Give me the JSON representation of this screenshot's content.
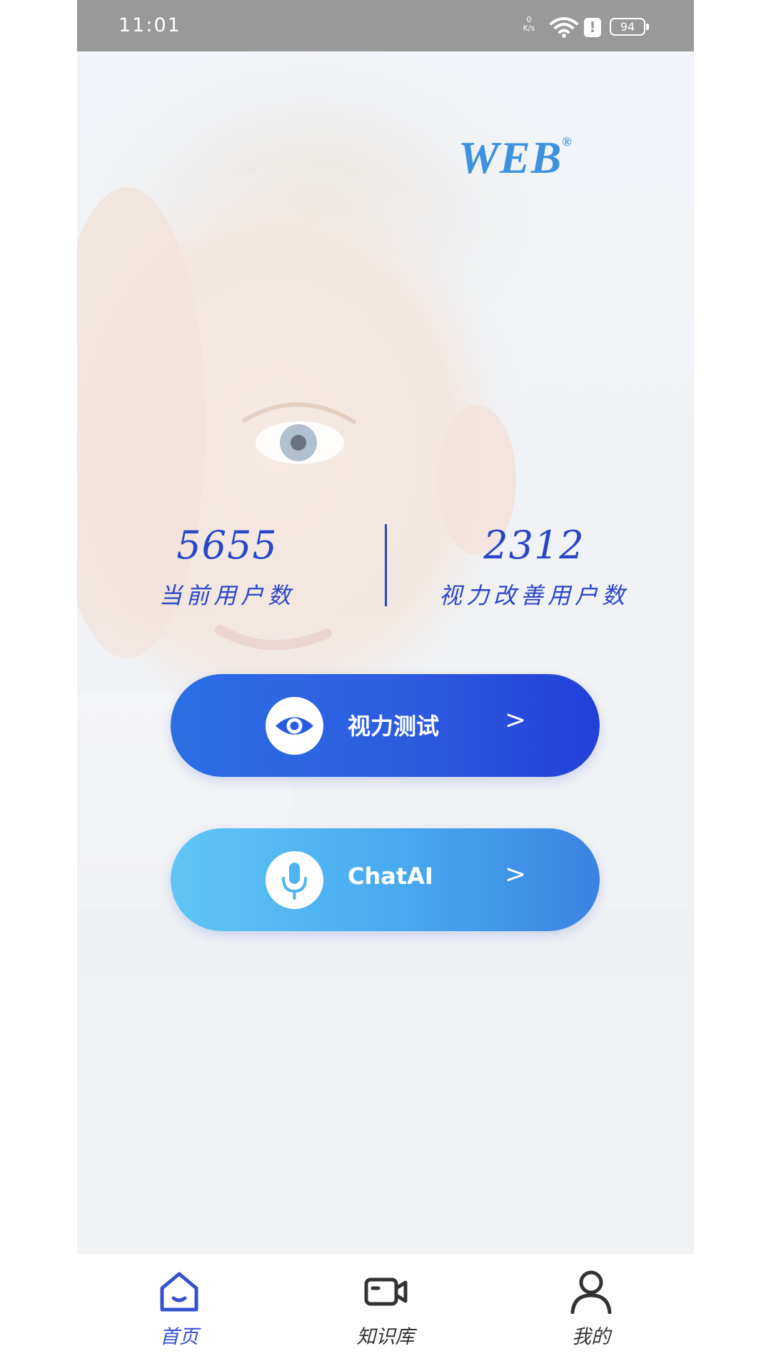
{
  "status_bar": {
    "time": "11:01",
    "net_speed_value": "0",
    "net_speed_unit": "K/s",
    "battery": "94"
  },
  "hero": {
    "logo_text": "WEB",
    "logo_mark": "®",
    "stats": [
      {
        "value": "5655",
        "label": "当前用户数"
      },
      {
        "value": "2312",
        "label": "视力改善用户数"
      }
    ]
  },
  "actions": [
    {
      "label": "视力测试",
      "icon": "eye-icon",
      "chevron": ">"
    },
    {
      "label": "ChatAI",
      "icon": "microphone-icon",
      "chevron": ">"
    }
  ],
  "bottom_nav": [
    {
      "label": "首页",
      "icon": "home-icon",
      "active": true
    },
    {
      "label": "知识库",
      "icon": "video-camera-icon",
      "active": false
    },
    {
      "label": "我的",
      "icon": "person-icon",
      "active": false
    }
  ],
  "colors": {
    "accent": "#3651cf",
    "vision_button": "#2a5ce0",
    "chat_button": "#4eb4f2",
    "logo": "#3d92e0"
  }
}
